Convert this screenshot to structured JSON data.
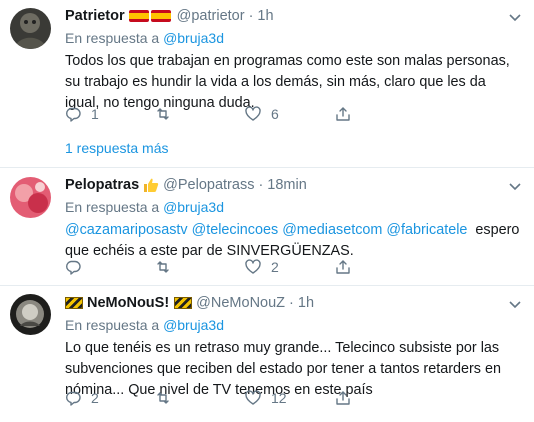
{
  "tweets": [
    {
      "name": "Patrietor",
      "handle": "@patrietor",
      "dot": "·",
      "time": "1h",
      "reply_prefix": "En respuesta a",
      "reply_to": "@bruja3d",
      "text": "Todos los que trabajan en programas como este son malas personas, su trabajo es hundir la vida a los demás, sin más, claro que les da igual, no tengo ninguna duda.",
      "reply_count": "1",
      "retweet_count": "",
      "like_count": "6",
      "more_replies": "1 respuesta más",
      "name_emoji": "spain-flag-icon x2"
    },
    {
      "name": "Pelopatras",
      "handle": "@Pelopatrass",
      "dot": "·",
      "time": "18min",
      "reply_prefix": "En respuesta a",
      "reply_to": "@bruja3d",
      "mentions": [
        "@cazamariposastv",
        "@telecincoes",
        "@mediasetcom",
        "@fabricatele"
      ],
      "text_line1_tail": "espero",
      "text_line2": "que echéis a este par de SINVERGÜENZAS.",
      "reply_count": "",
      "retweet_count": "",
      "like_count": "2",
      "name_emoji": "thumbs-up-icon"
    },
    {
      "name": "NeMoNouS!",
      "handle": "@NeMoNouZ",
      "dot": "·",
      "time": "1h",
      "reply_prefix": "En respuesta a",
      "reply_to": "@bruja3d",
      "text": "Lo que tenéis es un retraso muy grande... Telecinco subsiste por las subvenciones que reciben del estado por tener a tantos retarders en nómina... Que nivel de TV tenemos en este país",
      "reply_count": "2",
      "retweet_count": "",
      "like_count": "12",
      "name_emoji": "construction-barrier-icon"
    }
  ],
  "colors": {
    "link": "#1b95e0",
    "muted": "#657786",
    "text": "#14171a",
    "divider": "#e6ecf0"
  }
}
